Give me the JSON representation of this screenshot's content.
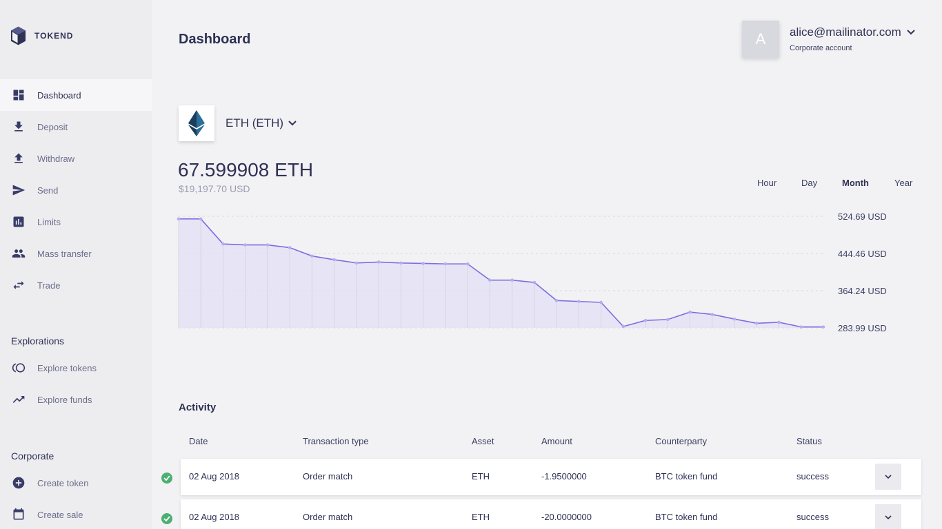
{
  "app": {
    "logo_text": "TOKEND"
  },
  "sidebar": {
    "items": [
      {
        "label": "Dashboard",
        "icon": "dashboard-icon"
      },
      {
        "label": "Deposit",
        "icon": "download-icon"
      },
      {
        "label": "Withdraw",
        "icon": "upload-icon"
      },
      {
        "label": "Send",
        "icon": "send-icon"
      },
      {
        "label": "Limits",
        "icon": "bar-chart-icon"
      },
      {
        "label": "Mass transfer",
        "icon": "people-icon"
      },
      {
        "label": "Trade",
        "icon": "swap-icon"
      }
    ],
    "explorations": {
      "title": "Explorations",
      "items": [
        {
          "label": "Explore tokens",
          "icon": "tokens-icon"
        },
        {
          "label": "Explore funds",
          "icon": "trending-up-icon"
        }
      ]
    },
    "corporate": {
      "title": "Corporate",
      "items": [
        {
          "label": "Create token",
          "icon": "add-circle-icon"
        },
        {
          "label": "Create sale",
          "icon": "calendar-icon"
        }
      ]
    }
  },
  "header": {
    "title": "Dashboard",
    "avatar_letter": "A",
    "email": "alice@mailinator.com",
    "account_type": "Corporate account"
  },
  "asset": {
    "name": "ETH (ETH)",
    "balance": "67.599908 ETH",
    "balance_usd": "$19,197.70 USD"
  },
  "periods": [
    "Hour",
    "Day",
    "Month",
    "Year"
  ],
  "active_period": "Month",
  "chart_data": {
    "type": "area",
    "y_ticks": [
      "524.69 USD",
      "444.46 USD",
      "364.24 USD",
      "283.99 USD"
    ],
    "ylim": [
      283.99,
      524.69
    ],
    "values": [
      519,
      519,
      465,
      463,
      463,
      457,
      439,
      431,
      424,
      426,
      424,
      423,
      422,
      422,
      387,
      387,
      382,
      343,
      341,
      339,
      287,
      300,
      302,
      318,
      313,
      303,
      294,
      296,
      286,
      286
    ],
    "colors": {
      "line": "#7b6fe0",
      "fill": "#e3def7",
      "grid": "#d6d6e0"
    }
  },
  "activity": {
    "title": "Activity",
    "columns": [
      "Date",
      "Transaction type",
      "Asset",
      "Amount",
      "Counterparty",
      "Status"
    ],
    "rows": [
      {
        "date": "02 Aug 2018",
        "type": "Order match",
        "asset": "ETH",
        "amount": "-1.9500000",
        "counterparty": "BTC token fund",
        "status": "success"
      },
      {
        "date": "02 Aug 2018",
        "type": "Order match",
        "asset": "ETH",
        "amount": "-20.0000000",
        "counterparty": "BTC token fund",
        "status": "success"
      }
    ]
  },
  "colors": {
    "accent": "#7b6fe0",
    "success": "#4caf73",
    "text": "#2f3155"
  }
}
